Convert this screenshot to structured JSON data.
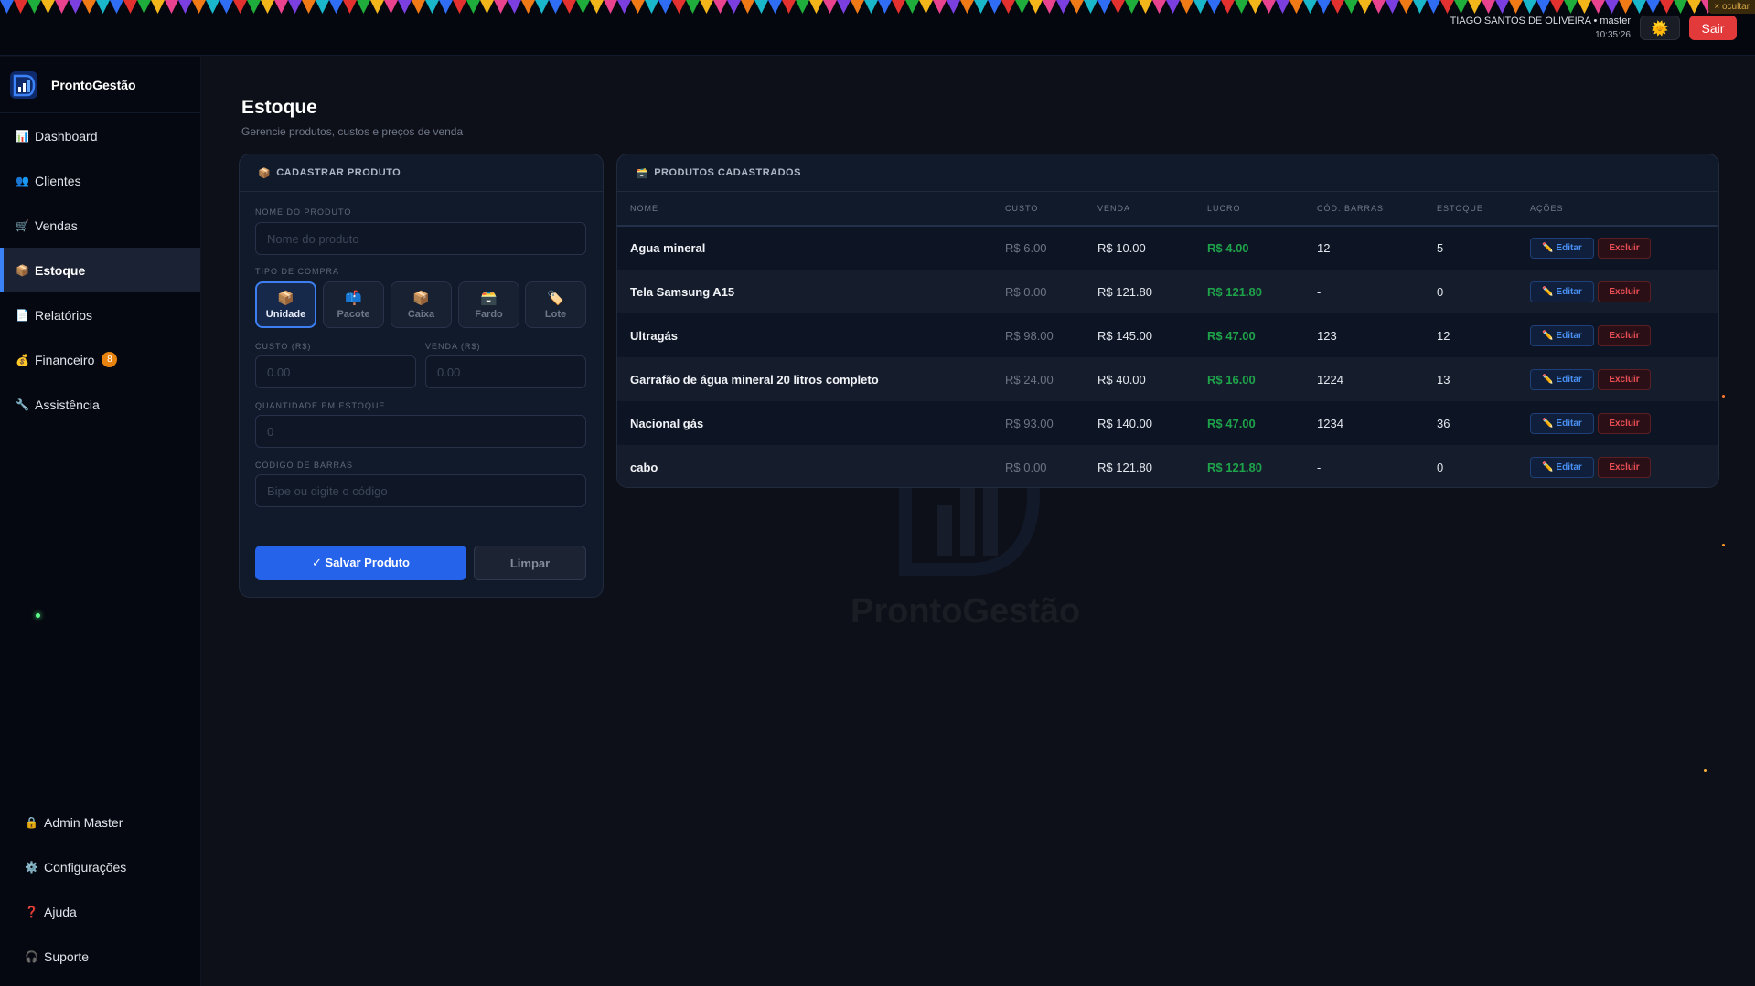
{
  "header": {
    "user_name": "TIAGO SANTOS DE OLIVEIRA • master",
    "time": "10:35:26",
    "theme_icon": "sun-icon",
    "logout_label": "Sair",
    "hide_label": "× ocultar",
    "colors": {
      "logout": "#e23a3a",
      "accent": "#3b82f6"
    }
  },
  "brand": {
    "name": "ProntoGestão"
  },
  "sidebar": {
    "items": [
      {
        "icon": "📊",
        "label": "Dashboard"
      },
      {
        "icon": "👥",
        "label": "Clientes"
      },
      {
        "icon": "🛒",
        "label": "Vendas"
      },
      {
        "icon": "📦",
        "label": "Estoque"
      },
      {
        "icon": "📄",
        "label": "Relatórios"
      },
      {
        "icon": "💰",
        "label": "Financeiro",
        "badge": "8"
      },
      {
        "icon": "🔧",
        "label": "Assistência"
      }
    ],
    "bottom": [
      {
        "icon": "🔒",
        "label": "Admin Master"
      },
      {
        "icon": "⚙️",
        "label": "Configurações"
      },
      {
        "icon": "❓",
        "label": "Ajuda"
      },
      {
        "icon": "🎧",
        "label": "Suporte"
      }
    ]
  },
  "page": {
    "title": "Estoque",
    "subtitle": "Gerencie produtos, custos e preços de venda"
  },
  "form": {
    "title": "CADASTRAR PRODUTO",
    "title_icon": "📦",
    "name_label": "NOME DO PRODUTO",
    "name_placeholder": "Nome do produto",
    "type_label": "TIPO DE COMPRA",
    "types": [
      {
        "icon": "📦",
        "label": "Unidade"
      },
      {
        "icon": "📫",
        "label": "Pacote"
      },
      {
        "icon": "📦",
        "label": "Caixa"
      },
      {
        "icon": "🗃️",
        "label": "Fardo"
      },
      {
        "icon": "🏷️",
        "label": "Lote"
      }
    ],
    "cost_label": "CUSTO (R$)",
    "cost_placeholder": "0.00",
    "sale_label": "VENDA (R$)",
    "sale_placeholder": "0.00",
    "qty_label": "QUANTIDADE EM ESTOQUE",
    "qty_placeholder": "0",
    "barcode_label": "CÓDIGO DE BARRAS",
    "barcode_placeholder": "Bipe ou digite o código",
    "save_label": "✓ Salvar Produto",
    "clear_label": "Limpar"
  },
  "products": {
    "title": "PRODUTOS CADASTRADOS",
    "title_icon": "🗃️",
    "columns": [
      "NOME",
      "CUSTO",
      "VENDA",
      "LUCRO",
      "CÓD. BARRAS",
      "ESTOQUE",
      "AÇÕES"
    ],
    "edit_label": "✏️ Editar",
    "delete_label": "Excluir",
    "rows": [
      {
        "name": "Agua mineral",
        "cost": "R$ 6.00",
        "sale": "R$ 10.00",
        "profit": "R$ 4.00",
        "barcode": "12",
        "stock": "5"
      },
      {
        "name": "Tela Samsung A15",
        "cost": "R$ 0.00",
        "sale": "R$ 121.80",
        "profit": "R$ 121.80",
        "barcode": "-",
        "stock": "0"
      },
      {
        "name": "Ultragás",
        "cost": "R$ 98.00",
        "sale": "R$ 145.00",
        "profit": "R$ 47.00",
        "barcode": "123",
        "stock": "12"
      },
      {
        "name": "Garrafão de água mineral 20 litros completo",
        "cost": "R$ 24.00",
        "sale": "R$ 40.00",
        "profit": "R$ 16.00",
        "barcode": "1224",
        "stock": "13"
      },
      {
        "name": "Nacional gás",
        "cost": "R$ 93.00",
        "sale": "R$ 140.00",
        "profit": "R$ 47.00",
        "barcode": "1234",
        "stock": "36"
      },
      {
        "name": "cabo",
        "cost": "R$ 0.00",
        "sale": "R$ 121.80",
        "profit": "R$ 121.80",
        "barcode": "-",
        "stock": "0"
      }
    ]
  },
  "watermark": {
    "text": "ProntoGestão"
  }
}
